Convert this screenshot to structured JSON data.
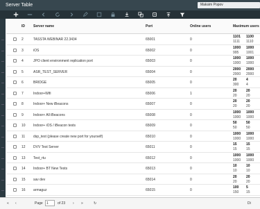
{
  "window": {
    "title": "Server Table",
    "user": "Maksim Popov"
  },
  "table": {
    "headers": {
      "id": "ID",
      "name": "Server name",
      "port": "Port",
      "online": "Online users",
      "max": "Maximum users"
    },
    "rows": [
      {
        "id": "2",
        "name": "TASSTA WEBINAR 22.3434",
        "port": "65001",
        "online": "0",
        "max": [
          "1101",
          "1100",
          "1111",
          "1110"
        ]
      },
      {
        "id": "3",
        "name": "iOS",
        "port": "65002",
        "online": "0",
        "max": [
          "1000",
          "1000",
          "995",
          "1001"
        ]
      },
      {
        "id": "4",
        "name": "JPO client environment replication port",
        "port": "65003",
        "online": "0",
        "max": [
          "1000",
          "1000",
          "1000",
          "1000"
        ]
      },
      {
        "id": "5",
        "name": "ASR_TEST_SERVER",
        "port": "65004",
        "online": "0",
        "max": [
          "2000",
          "2000",
          "2000",
          "2000"
        ]
      },
      {
        "id": "6",
        "name": "BRIDGE",
        "port": "65005",
        "online": "0",
        "max": [
          "20",
          "4",
          "300",
          "4"
        ]
      },
      {
        "id": "7",
        "name": "Indoor+Wifi",
        "port": "65006",
        "online": "1",
        "max": [
          "20",
          "20",
          "20",
          "20"
        ]
      },
      {
        "id": "8",
        "name": "Indoor+ New iBeacons",
        "port": "65007",
        "online": "0",
        "max": [
          "20",
          "20",
          "20",
          "20"
        ]
      },
      {
        "id": "9",
        "name": "Indoor+ All iBeacons",
        "port": "65008",
        "online": "0",
        "max": [
          "1000",
          "1000",
          "1000",
          "1000"
        ]
      },
      {
        "id": "10",
        "name": "Indoor+ iOS / iBeacon tests",
        "port": "65009",
        "online": "0",
        "max": [
          "50",
          "50",
          "50",
          "50"
        ]
      },
      {
        "id": "11",
        "name": "dsp_test (please create new port for yourself)",
        "port": "65010",
        "online": "0",
        "max": [
          "1000",
          "1000",
          "1000",
          "1000"
        ]
      },
      {
        "id": "12",
        "name": "DVV Test Server",
        "port": "65011",
        "online": "0",
        "max": [
          "15",
          "15",
          "15",
          "15"
        ]
      },
      {
        "id": "13",
        "name": "Test_rtu",
        "port": "65012",
        "online": "0",
        "max": [
          "1000",
          "1000",
          "1000",
          "1000"
        ]
      },
      {
        "id": "14",
        "name": "Indoor+ BT New Tests",
        "port": "65013",
        "online": "0",
        "max": [
          "10",
          "10",
          "10",
          "10"
        ]
      },
      {
        "id": "15",
        "name": "sav dev",
        "port": "65014",
        "online": "0",
        "max": [
          "20",
          "20",
          "20",
          "20"
        ]
      },
      {
        "id": "16",
        "name": "armaguz",
        "port": "65015",
        "online": "0",
        "max": [
          "100",
          "5",
          "150",
          "15"
        ]
      }
    ]
  },
  "pager": {
    "page_label": "Page",
    "page_value": "1",
    "of_label": "of 23",
    "right_text": "Di"
  },
  "icons": [
    "add-icon",
    "delete-icon",
    "back-icon",
    "refresh-icon",
    "forward-icon",
    "edit-icon",
    "grid-icon",
    "lock-icon",
    "download-icon",
    "copy-icon",
    "export-icon",
    "import-icon",
    "filter-icon"
  ]
}
